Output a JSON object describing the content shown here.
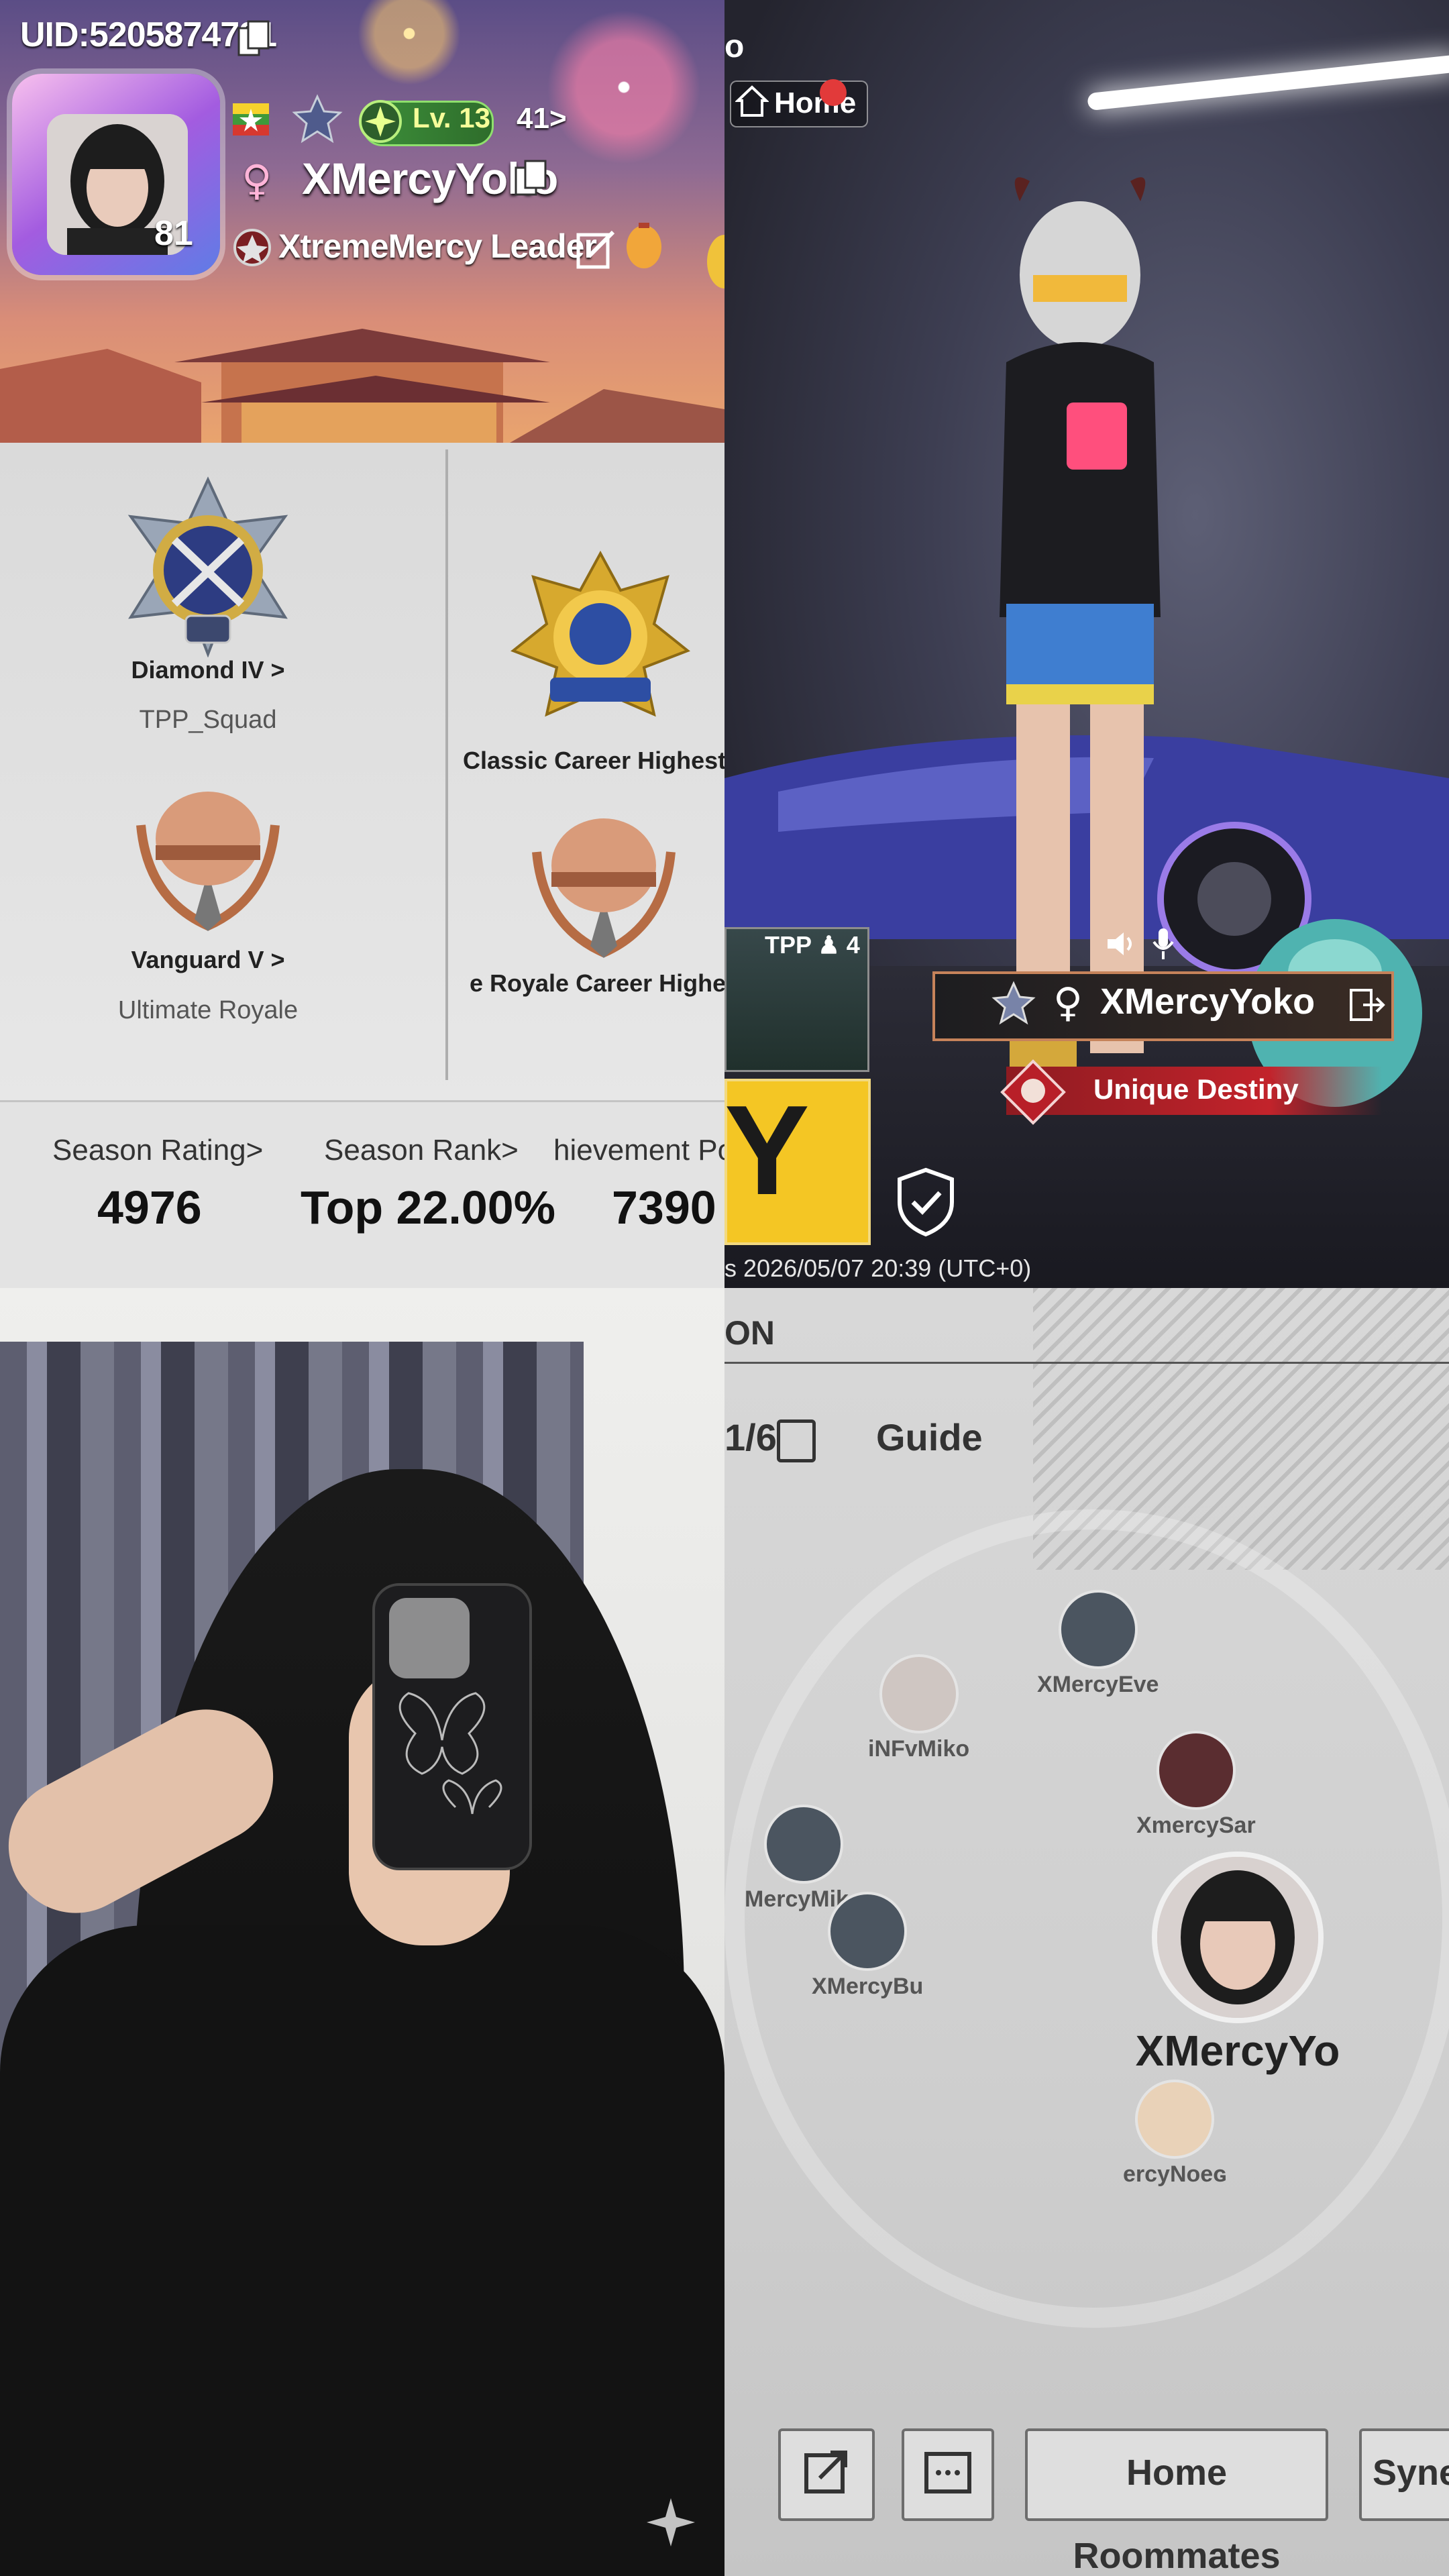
{
  "profile": {
    "uid_text": "UID:5205874721",
    "player_name": "XMercyYoko",
    "avatar_level": "81",
    "level_badge": "Lv. 13",
    "rp_text": "41>",
    "clan_text": "XtremeMercy  Leader",
    "ranks": {
      "diamond": {
        "label": "Diamond IV >",
        "sub": "TPP_Squad"
      },
      "classic_highest": {
        "label": "Classic Career Highest >"
      },
      "vanguard": {
        "label": "Vanguard V >",
        "sub": "Ultimate Royale"
      },
      "royale_highest": {
        "label": "e Royale Career Highest >"
      }
    },
    "stats": [
      {
        "label": "Season Rating>",
        "value": "4976"
      },
      {
        "label": "Season Rank>",
        "value": "Top 22.00%"
      },
      {
        "label": "hievement Poi",
        "value": "7390"
      }
    ]
  },
  "scene": {
    "top_fragment": "o",
    "home_label": "Home",
    "mode_label": "TPP",
    "mode_count": "4",
    "nameplate_name": "XMercyYoko",
    "title_badge": "Unique Destiny",
    "yellow_letter": "Y",
    "timestamp": "s 2026/05/07 20:39 (UTC+0)"
  },
  "social": {
    "header_fragment": "ON",
    "count": "1/6",
    "guide_label": "Guide",
    "friends": [
      {
        "name": "iNFvMiko"
      },
      {
        "name": "XMercyEve"
      },
      {
        "name": "XmercySar"
      },
      {
        "name": "MercyMiko"
      },
      {
        "name": "XMercyBu"
      },
      {
        "name": "ercyNoeɢ"
      }
    ],
    "me_name": "XMercyYo",
    "buttons": {
      "roommates": "Home Roommates",
      "syner": "Syner"
    }
  },
  "colors": {
    "accent_green": "#3d8f3a",
    "badge_red": "#c2232b",
    "tile_yellow": "#f4c624"
  }
}
